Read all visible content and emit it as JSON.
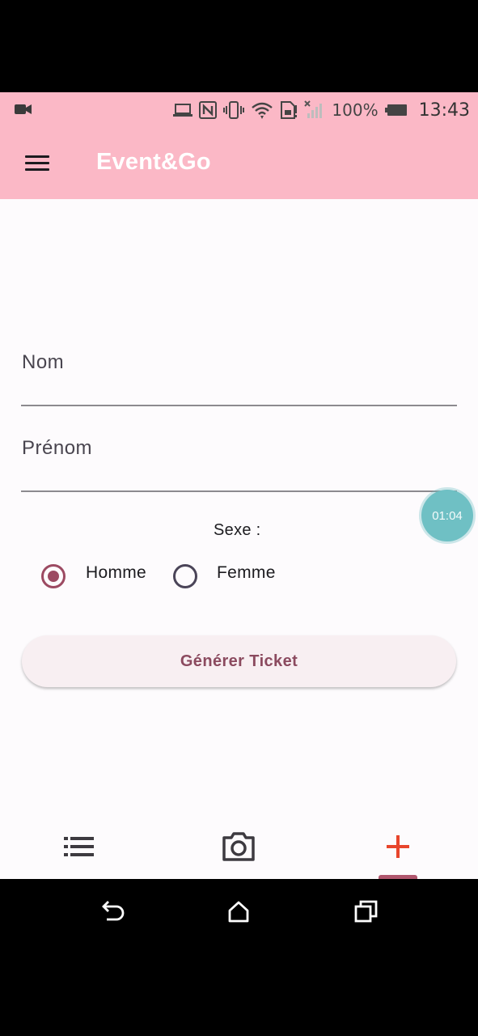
{
  "status_bar": {
    "battery_percent": "100%",
    "time": "13:43",
    "icons": [
      "video-camera-icon",
      "laptop-icon",
      "nfc-icon",
      "vibrate-icon",
      "wifi-icon",
      "sim-icon",
      "no-signal-icon",
      "battery-icon"
    ]
  },
  "app_bar": {
    "title": "Event&Go",
    "menu_icon": "hamburger-menu-icon"
  },
  "form": {
    "nom_label": "Nom",
    "prenom_label": "Prénom",
    "sexe_label": "Sexe :",
    "options": [
      {
        "label": "Homme",
        "checked": true
      },
      {
        "label": "Femme",
        "checked": false
      }
    ],
    "submit_label": "Générer Ticket"
  },
  "timer_overlay": {
    "text": "01:04"
  },
  "bottom_nav": {
    "items": [
      {
        "icon": "list-icon",
        "active": false
      },
      {
        "icon": "camera-icon",
        "active": false
      },
      {
        "icon": "plus-icon",
        "active": true
      }
    ]
  },
  "system_nav": {
    "icons": [
      "back-icon",
      "home-icon",
      "recents-icon"
    ]
  },
  "colors": {
    "app_bar": "#fbb8c6",
    "accent": "#9c4a62",
    "button_text": "#8b4a5f",
    "active_nav_icon": "#e8452c",
    "timer_bg": "#6fc0c4"
  }
}
